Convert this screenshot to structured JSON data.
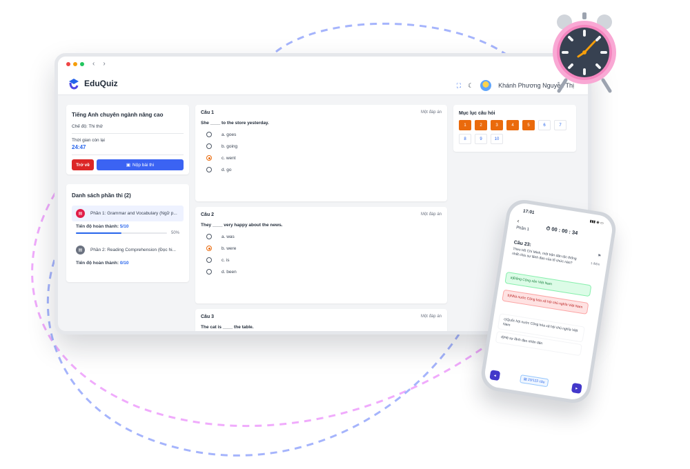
{
  "app": {
    "brand": "EduQuiz"
  },
  "header": {
    "user_name": "Khánh Phương Nguyễn Thị"
  },
  "exam": {
    "title": "Tiếng Anh chuyên ngành nâng cao",
    "mode_label": "Chế độ: Thi thử",
    "time_label": "Thời gian còn lại",
    "time_remaining": "24:47",
    "back_label": "Trở về",
    "submit_label": "Nộp bài thi"
  },
  "sections": {
    "title": "Danh sách phần thi (2)",
    "items": [
      {
        "label": "Phần 1: Grammar and Vocabulary (Ngữ p...",
        "progress_label": "Tiến độ hoàn thành:",
        "progress": "5/10",
        "percent": "50%",
        "fraction": 0.5,
        "active": true,
        "color": "#e11d48"
      },
      {
        "label": "Phần 2: Reading Comprehension (Đọc hi...",
        "progress_label": "Tiến độ hoàn thành:",
        "progress": "0/10",
        "percent": "",
        "fraction": 0,
        "active": false,
        "color": "#6b7280"
      }
    ]
  },
  "questions": [
    {
      "number": "Câu 1",
      "type": "Một đáp án",
      "text": "She ____ to the store yesterday.",
      "options": [
        {
          "label": "a. goes",
          "selected": false
        },
        {
          "label": "b. going",
          "selected": false
        },
        {
          "label": "c. went",
          "selected": true
        },
        {
          "label": "d. go",
          "selected": false
        }
      ]
    },
    {
      "number": "Câu 2",
      "type": "Một đáp án",
      "text": "They ____ very happy about the news.",
      "options": [
        {
          "label": "a. was",
          "selected": false
        },
        {
          "label": "b. were",
          "selected": true
        },
        {
          "label": "c. is",
          "selected": false
        },
        {
          "label": "d. been",
          "selected": false
        }
      ]
    },
    {
      "number": "Câu 3",
      "type": "Một đáp án",
      "text": "The cat is ____ the table.",
      "options": []
    }
  ],
  "index": {
    "title": "Mục lục câu hỏi",
    "cells": [
      {
        "n": "1",
        "done": true
      },
      {
        "n": "2",
        "done": true
      },
      {
        "n": "3",
        "done": true
      },
      {
        "n": "4",
        "done": true
      },
      {
        "n": "5",
        "done": true
      },
      {
        "n": "6",
        "done": false
      },
      {
        "n": "7",
        "done": false
      },
      {
        "n": "8",
        "done": false
      },
      {
        "n": "9",
        "done": false
      },
      {
        "n": "10",
        "done": false
      }
    ]
  },
  "phone": {
    "time": "17:01",
    "timer": "⏱ 00 : 00 : 34",
    "part": "Phần 1",
    "question_number": "Câu 23:",
    "points": "1 điểm",
    "question_text": "Theo Hồ Chí Minh, một trận dân tộc thống nhất chịu sự lãnh đạo của tổ chức nào?",
    "options": [
      {
        "label": "a)Đảng Cộng sản Việt Nam",
        "state": "correct"
      },
      {
        "label": "b)Nhà nước Cộng hòa xã hội chủ nghĩa Việt Nam",
        "state": "wrong"
      },
      {
        "label": "c)Quốc hội nước Cộng hòa xã hội chủ nghĩa Việt Nam",
        "state": "normal"
      },
      {
        "label": "d)Hệ sự lãnh đạo nhân dân",
        "state": "normal"
      }
    ],
    "counter": "▤ 23/122 câu"
  },
  "colors": {
    "accent": "#2563eb",
    "answered": "#ea6a0c",
    "danger": "#dc2626",
    "submit": "#3b63f3"
  }
}
